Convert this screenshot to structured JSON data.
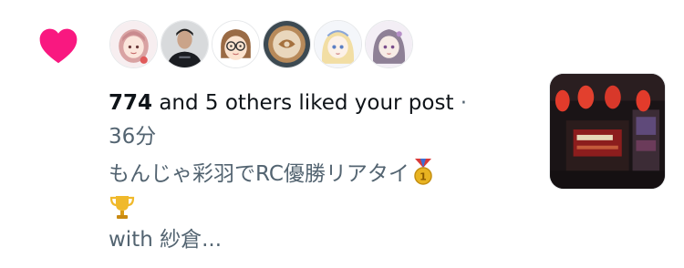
{
  "notification": {
    "type_icon": "heart-icon",
    "accent_color": "#f91880",
    "actor": "774",
    "summary": " and 5 others liked your post",
    "separator": " ·",
    "time": "36分",
    "avatars": [
      {
        "name": "avatar-pink-hair-girl-icon"
      },
      {
        "name": "avatar-man-dark-shirt-icon"
      },
      {
        "name": "avatar-glasses-cartoon-icon"
      },
      {
        "name": "avatar-latte-art-icon"
      },
      {
        "name": "avatar-blonde-anime-icon"
      },
      {
        "name": "avatar-silver-hair-anime-icon"
      }
    ]
  },
  "post": {
    "line1": "もんじゃ彩羽でRC優勝リアタイ",
    "line1_emoji": "medal-icon",
    "line2_emoji": "trophy-icon",
    "line3": "with 紗倉...",
    "thumbnail": "restaurant-photo-thumbnail"
  }
}
